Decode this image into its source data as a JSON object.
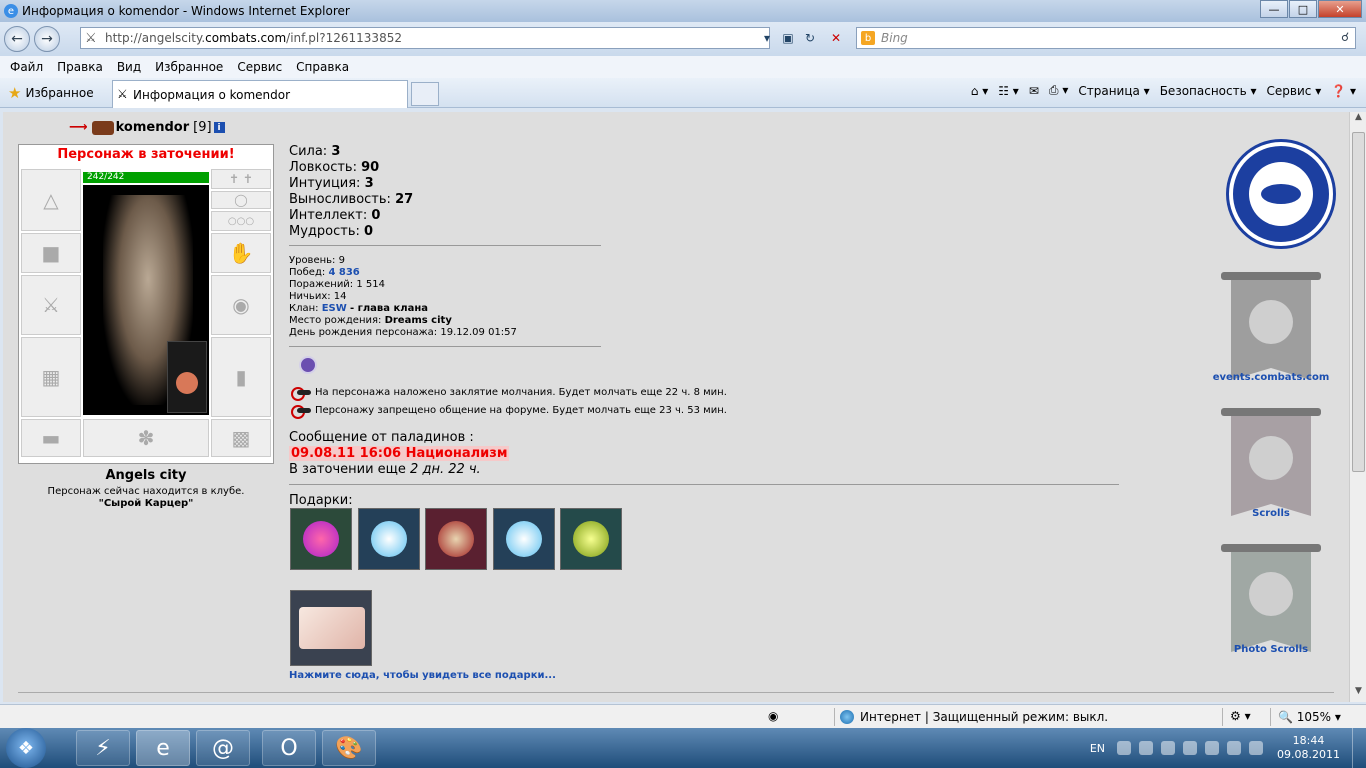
{
  "window": {
    "title": "Информация о komendor - Windows Internet Explorer"
  },
  "address": {
    "url_prefix": "http://angelscity.",
    "url_domain": "combats.com",
    "url_suffix": "/inf.pl?1261133852",
    "search_placeholder": "Bing"
  },
  "menu": [
    "Файл",
    "Правка",
    "Вид",
    "Избранное",
    "Сервис",
    "Справка"
  ],
  "favorites": {
    "label": "Избранное",
    "tab_title": "Информация о komendor"
  },
  "commandbar": {
    "page": "Страница ▾",
    "safety": "Безопасность ▾",
    "tools": "Сервис ▾"
  },
  "character": {
    "name": "komendor",
    "level": "[9]",
    "prison_status": "Персонаж в заточении!",
    "hp": "242/242",
    "city": "Angels city",
    "club_text": "Персонаж сейчас находится в клубе.",
    "club_name": "\"Сырой Карцер\""
  },
  "stats": {
    "strength_label": "Сила:",
    "strength": "3",
    "agility_label": "Ловкость:",
    "agility": "90",
    "intuition_label": "Интуиция:",
    "intuition": "3",
    "endurance_label": "Выносливость:",
    "endurance": "27",
    "intellect_label": "Интеллект:",
    "intellect": "0",
    "wisdom_label": "Мудрость:",
    "wisdom": "0"
  },
  "info": {
    "level_label": "Уровень:",
    "level": "9",
    "wins_label": "Побед:",
    "wins": "4 836",
    "losses_label": "Поражений:",
    "losses": "1 514",
    "draws_label": "Ничьих:",
    "draws": "14",
    "clan_label": "Клан:",
    "clan": "ESW",
    "clan_role": "- глава клана",
    "birthplace_label": "Место рождения:",
    "birthplace": "Dreams city",
    "birthday_label": "День рождения персонажа:",
    "birthday": "19.12.09 01:57"
  },
  "silence": {
    "chat": "На персонажа наложено заклятие молчания. Будет молчать еще 22 ч. 8 мин.",
    "forum": "Персонажу запрещено общение на форуме. Будет молчать еще 23 ч. 53 мин."
  },
  "paladins": {
    "header": "Сообщение от паладинов :",
    "message": "09.08.11 16:06 Национализм",
    "prison_prefix": "В заточении еще",
    "prison_time": "2 дн. 22 ч."
  },
  "gifts": {
    "label": "Подарки:",
    "link": "Нажмите сюда, чтобы увидеть все подарки..."
  },
  "sidebar": {
    "events": "events.combats.com",
    "scrolls": "Scrolls",
    "photo_scrolls": "Photo Scrolls"
  },
  "statusbar": {
    "zone": "Интернет | Защищенный режим: выкл.",
    "zoom": "105%"
  },
  "tray": {
    "lang": "EN",
    "time": "18:44",
    "date": "09.08.2011"
  },
  "colors": {
    "prison_red": "#e00000",
    "link_blue": "#1c4fb0",
    "hp_green": "#00a000"
  }
}
